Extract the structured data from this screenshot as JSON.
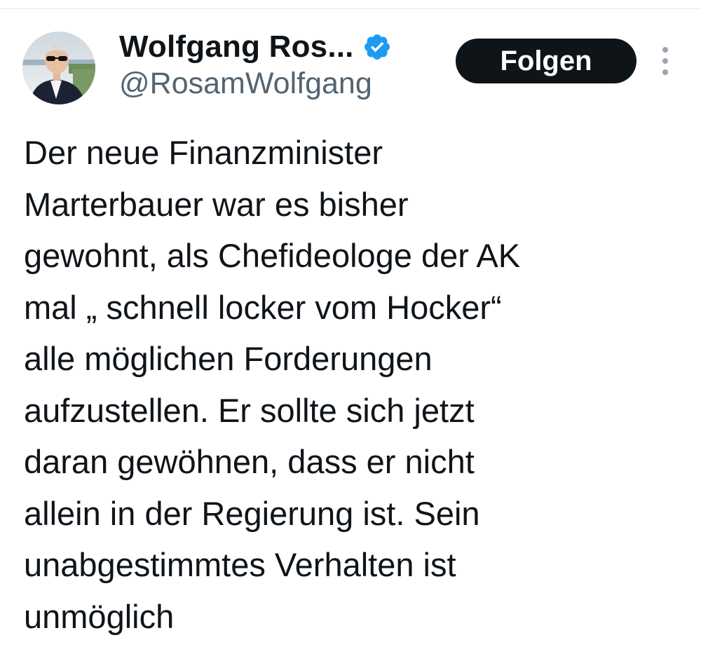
{
  "author": {
    "display_name": "Wolfgang Ros...",
    "handle": "@RosamWolfgang",
    "verified": true,
    "avatar_icon": "profile-photo"
  },
  "actions": {
    "follow_label": "Folgen",
    "more_icon": "more-vertical-icon"
  },
  "tweet": {
    "lines": [
      "Der neue Finanzminister",
      "Marterbauer war es bisher",
      "gewohnt, als Chefideologe der AK",
      "mal „ schnell locker vom Hocker“",
      "alle möglichen Forderungen",
      "aufzustellen. Er sollte sich jetzt",
      "daran gewöhnen, dass er nicht",
      "allein in der Regierung ist. Sein",
      "unabgestimmtes Verhalten ist",
      "unmöglich"
    ]
  },
  "colors": {
    "text": "#0f1419",
    "secondary_text": "#536471",
    "verified_badge": "#1d9bf0",
    "button_bg": "#0f1419",
    "button_text": "#ffffff",
    "background": "#ffffff"
  }
}
